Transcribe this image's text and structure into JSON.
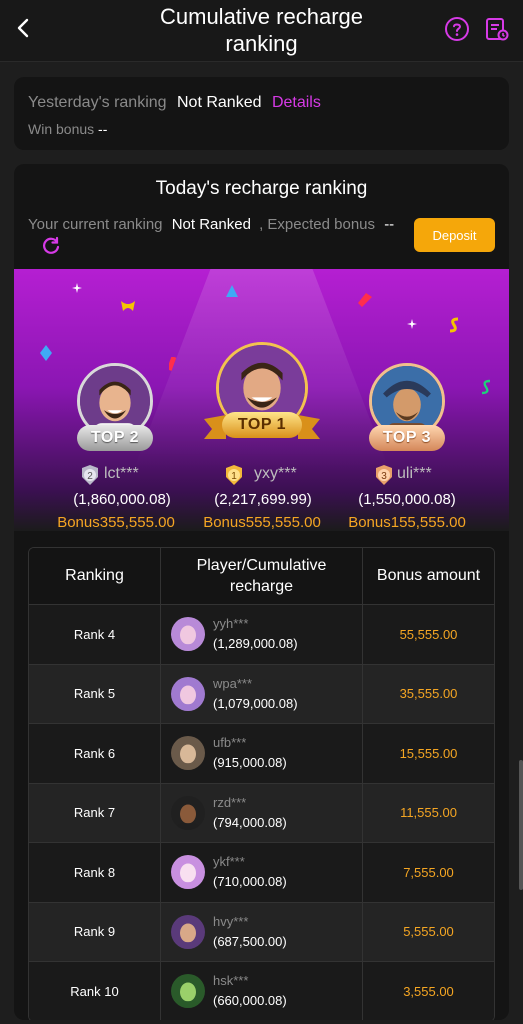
{
  "header": {
    "title_line1": "Cumulative recharge",
    "title_line2": "ranking",
    "icons": [
      "back-icon",
      "help-icon",
      "document-icon"
    ]
  },
  "yesterday": {
    "label": "Yesterday's ranking",
    "status": "Not Ranked",
    "details": "Details",
    "win_bonus_label": "Win bonus",
    "win_bonus_value": "--"
  },
  "today": {
    "title": "Today's recharge ranking",
    "current_label": "Your current ranking",
    "current_value": "Not Ranked",
    "expected_label": ", Expected bonus",
    "expected_value": "--",
    "deposit_label": "Deposit"
  },
  "podium": [
    {
      "rank": "2",
      "badge": "TOP 2",
      "name": "lct***",
      "amount": "(1,860,000.08)",
      "bonus_label": "Bonus",
      "bonus": "355,555.00"
    },
    {
      "rank": "1",
      "badge": "TOP 1",
      "name": "yxy***",
      "amount": "(2,217,699.99)",
      "bonus_label": "Bonus",
      "bonus": "555,555.00"
    },
    {
      "rank": "3",
      "badge": "TOP 3",
      "name": "uli***",
      "amount": "(1,550,000.08)",
      "bonus_label": "Bonus",
      "bonus": "155,555.00"
    }
  ],
  "table": {
    "headers": [
      "Ranking",
      "Player/Cumulative",
      "recharge",
      "Bonus amount"
    ],
    "rows": [
      {
        "rank": "Rank 4",
        "name": "yyh***",
        "amount": "(1,289,000.08)",
        "bonus": "55,555.00"
      },
      {
        "rank": "Rank 5",
        "name": "wpa***",
        "amount": "(1,079,000.08)",
        "bonus": "35,555.00"
      },
      {
        "rank": "Rank 6",
        "name": "ufb***",
        "amount": "(915,000.08)",
        "bonus": "15,555.00"
      },
      {
        "rank": "Rank 7",
        "name": "rzd***",
        "amount": "(794,000.08)",
        "bonus": "11,555.00"
      },
      {
        "rank": "Rank 8",
        "name": "ykf***",
        "amount": "(710,000.08)",
        "bonus": "7,555.00"
      },
      {
        "rank": "Rank 9",
        "name": "hvy***",
        "amount": "(687,500.00)",
        "bonus": "5,555.00"
      },
      {
        "rank": "Rank 10",
        "name": "hsk***",
        "amount": "(660,000.08)",
        "bonus": "3,555.00"
      }
    ]
  },
  "colors": {
    "accent": "#d63ae6",
    "gold": "#f5a623",
    "deposit": "#f5a70a"
  }
}
